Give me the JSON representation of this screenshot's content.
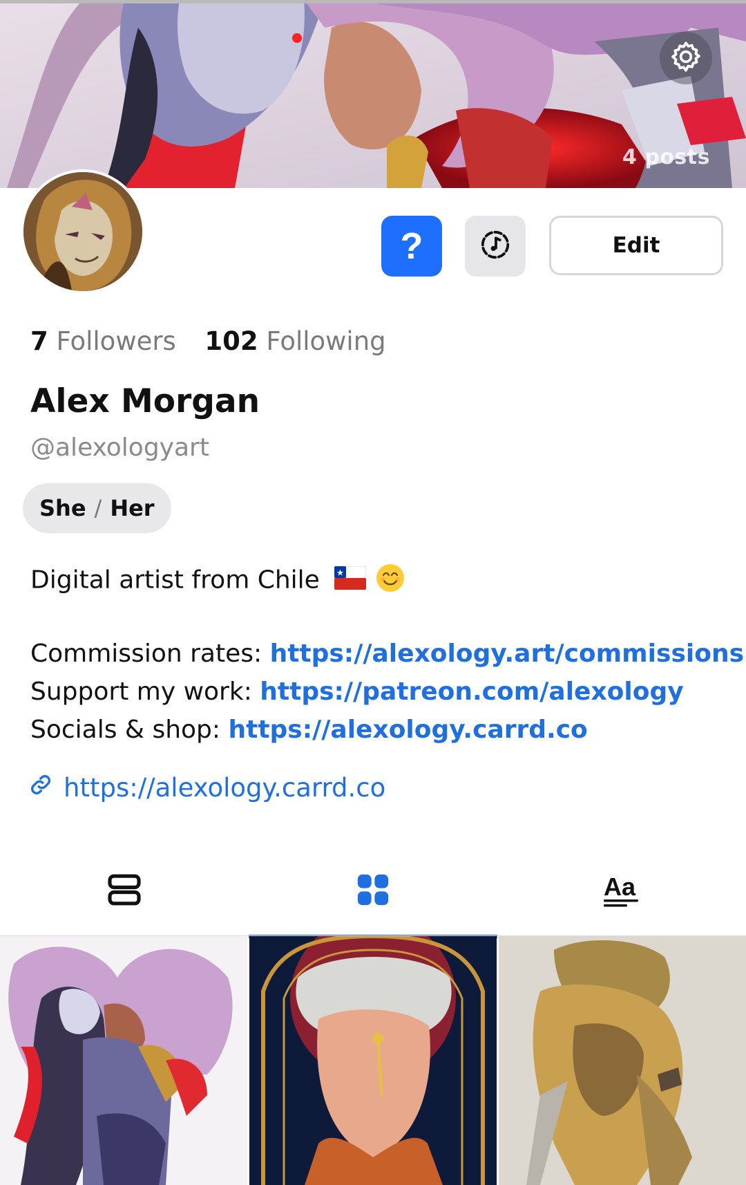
{
  "profile": {
    "posts_count": "4 posts",
    "followers_count": "7",
    "followers_label": "Followers",
    "following_count": "102",
    "following_label": "Following",
    "display_name": "Alex Morgan",
    "handle": "@alexologyart",
    "pronoun_1": "She",
    "pronoun_sep": "/",
    "pronoun_2": "Her",
    "website": "https://alexology.carrd.co"
  },
  "actions": {
    "help_label": "?",
    "edit_label": "Edit"
  },
  "bio": {
    "line1": "Digital artist from Chile",
    "commission_label": "Commission rates: ",
    "commission_url": "https://alexology.art/commissions",
    "support_label": "Support my work: ",
    "support_url": "https://patreon.com/alexology",
    "socials_label": "Socials & shop: ",
    "socials_url": "https://alexology.carrd.co"
  },
  "tabs": [
    {
      "icon": "list-view-icon",
      "active": false
    },
    {
      "icon": "grid-view-icon",
      "active": true
    },
    {
      "icon": "text-posts-icon",
      "active": false
    }
  ],
  "colors": {
    "accent": "#1f6fe0",
    "help_button": "#1f6fff",
    "link": "#1f6fe0",
    "muted_text": "#7a7a7a"
  }
}
